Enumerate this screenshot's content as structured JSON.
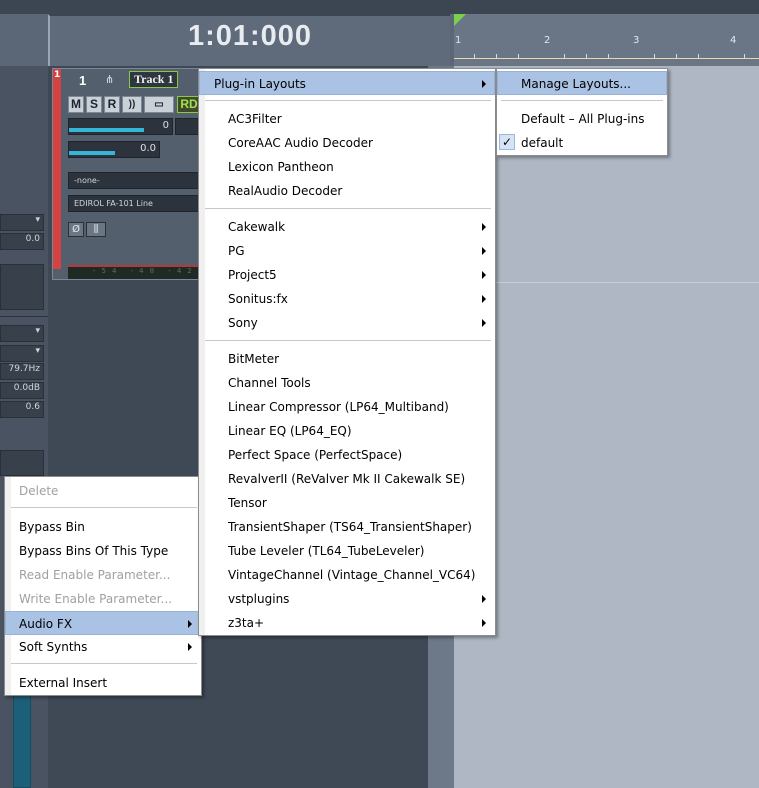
{
  "transport": {
    "time": "1:01:000"
  },
  "ruler": {
    "marks": [
      "1",
      "2",
      "3",
      "4"
    ]
  },
  "left_panel": {
    "values": [
      "0.0",
      "79.7Hz",
      "0.0dB",
      "0.6"
    ]
  },
  "track": {
    "number": "1",
    "name": "Track 1",
    "buttons": {
      "mute": "M",
      "solo": "S",
      "record": "R",
      "input_echo": "))",
      "read": "RD"
    },
    "volume_value": "0",
    "pan_value": "0.0",
    "input": "-none-",
    "output": "EDIROL FA-101 Line",
    "phase_symbol": "Ø",
    "meter_scale": "-54 -48 -42",
    "flag_number": "1"
  },
  "context_menu": {
    "items": [
      {
        "label": "Delete",
        "underline": "D",
        "disabled": true
      },
      {
        "label": "Bypass Bin",
        "underline": "B",
        "disabled": false
      },
      {
        "label": "Bypass Bins Of This Type",
        "underline": "y",
        "disabled": false
      },
      {
        "label": "Read Enable Parameter...",
        "underline": "R",
        "disabled": true
      },
      {
        "label": "Write Enable Parameter...",
        "underline": "W",
        "disabled": true
      },
      {
        "label": "Audio FX",
        "underline": "A",
        "disabled": false,
        "submenu": true,
        "highlighted": true
      },
      {
        "label": "Soft Synths",
        "underline": "S",
        "disabled": false,
        "submenu": true
      },
      {
        "label": "External Insert",
        "underline": "",
        "disabled": false
      }
    ]
  },
  "audio_fx_menu": {
    "plugin_layouts": "Plug-in Layouts",
    "group1": [
      "AC3Filter",
      "CoreAAC Audio Decoder",
      "Lexicon Pantheon",
      "RealAudio Decoder"
    ],
    "group2": [
      "Cakewalk",
      "PG",
      "Project5",
      "Sonitus:fx",
      "Sony"
    ],
    "group3": [
      "BitMeter",
      "Channel Tools",
      "Linear Compressor (LP64_Multiband)",
      "Linear EQ (LP64_EQ)",
      "Perfect Space (PerfectSpace)",
      "RevalverII (ReValver Mk II Cakewalk SE)",
      "Tensor",
      "TransientShaper (TS64_TransientShaper)",
      "Tube Leveler (TL64_TubeLeveler)",
      "VintageChannel (Vintage_Channel_VC64)",
      "vstplugins",
      "z3ta+"
    ]
  },
  "layouts_menu": {
    "manage": "Manage Layouts...",
    "default_all": "Default – All Plug-ins",
    "default": "default",
    "check": "✓"
  },
  "colors": {
    "menu_highlight": "#aac2e4",
    "track_accent": "#8ac84a",
    "record_flag": "#d44242"
  }
}
